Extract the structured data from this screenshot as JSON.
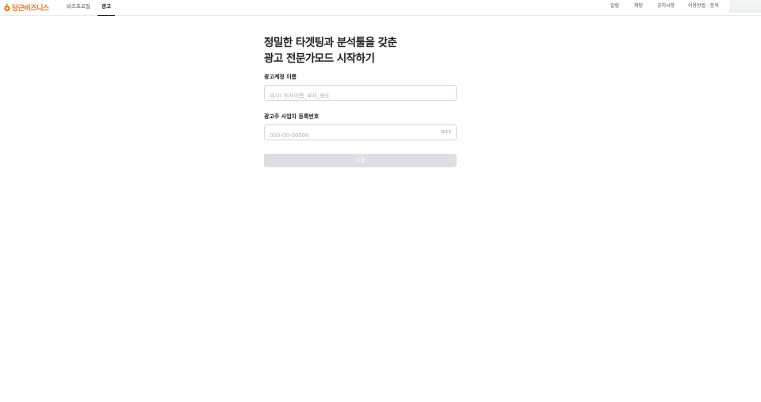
{
  "header": {
    "logo_text": "당근비즈니스",
    "tabs": [
      {
        "label": "비즈프로필",
        "active": false
      },
      {
        "label": "광고",
        "active": true
      }
    ],
    "right_links": [
      "알림",
      "채팅",
      "공지사항",
      "이용방법 · 문의"
    ]
  },
  "main": {
    "heading_line1": "정밀한 타겟팅과 분석툴을 갖춘",
    "heading_line2": "광고 전문가모드 시작하기",
    "account_name": {
      "label": "광고계정 이름",
      "value": "",
      "placeholder": "예시) 회사이름_부서_용도"
    },
    "business_number": {
      "label": "광고주 사업자 등록번호",
      "value": "",
      "placeholder": "000-00-00000",
      "counter": "0/10"
    },
    "next_button": "다음"
  },
  "colors": {
    "brand": "#ff6f0f",
    "text": "#212124",
    "input_border": "#d1d3d8",
    "button_disabled": "#dcdee3"
  }
}
